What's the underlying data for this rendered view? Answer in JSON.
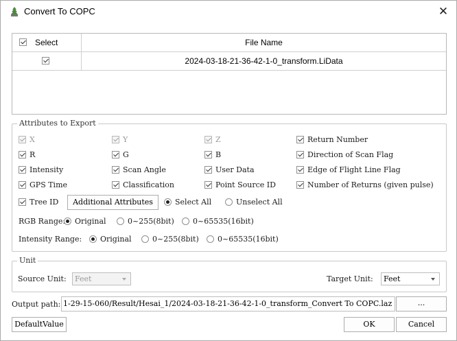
{
  "window": {
    "title": "Convert To COPC",
    "close_glyph": "✕"
  },
  "table": {
    "headers": {
      "select": "Select",
      "file_name": "File Name"
    },
    "header_checked": true,
    "rows": [
      {
        "checked": true,
        "file_name": "2024-03-18-21-36-42-1-0_transform.LiData"
      }
    ]
  },
  "attributes": {
    "title": "Attributes to Export",
    "items": [
      {
        "label": "X",
        "checked": true,
        "enabled": false
      },
      {
        "label": "Y",
        "checked": true,
        "enabled": false
      },
      {
        "label": "Z",
        "checked": true,
        "enabled": false
      },
      {
        "label": "Return Number",
        "checked": true,
        "enabled": true
      },
      {
        "label": "R",
        "checked": true,
        "enabled": true
      },
      {
        "label": "G",
        "checked": true,
        "enabled": true
      },
      {
        "label": "B",
        "checked": true,
        "enabled": true
      },
      {
        "label": "Direction of Scan Flag",
        "checked": true,
        "enabled": true
      },
      {
        "label": "Intensity",
        "checked": true,
        "enabled": true
      },
      {
        "label": "Scan Angle",
        "checked": true,
        "enabled": true
      },
      {
        "label": "User Data",
        "checked": true,
        "enabled": true
      },
      {
        "label": "Edge of Flight Line Flag",
        "checked": true,
        "enabled": true
      },
      {
        "label": "GPS Time",
        "checked": true,
        "enabled": true
      },
      {
        "label": "Classification",
        "checked": true,
        "enabled": true
      },
      {
        "label": "Point Source ID",
        "checked": true,
        "enabled": true
      },
      {
        "label": "Number of Returns (given pulse)",
        "checked": true,
        "enabled": true
      }
    ],
    "tree_id": {
      "label": "Tree ID",
      "checked": true
    },
    "additional_button": "Additional Attributes",
    "select_all": "Select All",
    "unselect_all": "Unselect All",
    "rgb_range": {
      "label": "RGB Range:",
      "options": [
        "Original",
        "0~255(8bit)",
        "0~65535(16bit)"
      ],
      "selected": 0
    },
    "intensity_range": {
      "label": "Intensity Range:",
      "options": [
        "Original",
        "0~255(8bit)",
        "0~65535(16bit)"
      ],
      "selected": 0
    }
  },
  "unit": {
    "title": "Unit",
    "source_label": "Source Unit:",
    "source_value": "Feet",
    "target_label": "Target Unit:",
    "target_value": "Feet"
  },
  "output": {
    "label": "Output path:",
    "value": "1-29-15-060/Result/Hesai_1/2024-03-18-21-36-42-1-0_transform_Convert To COPC.laz",
    "browse_label": "..."
  },
  "buttons": {
    "default": "DefaultValue",
    "ok": "OK",
    "cancel": "Cancel"
  }
}
